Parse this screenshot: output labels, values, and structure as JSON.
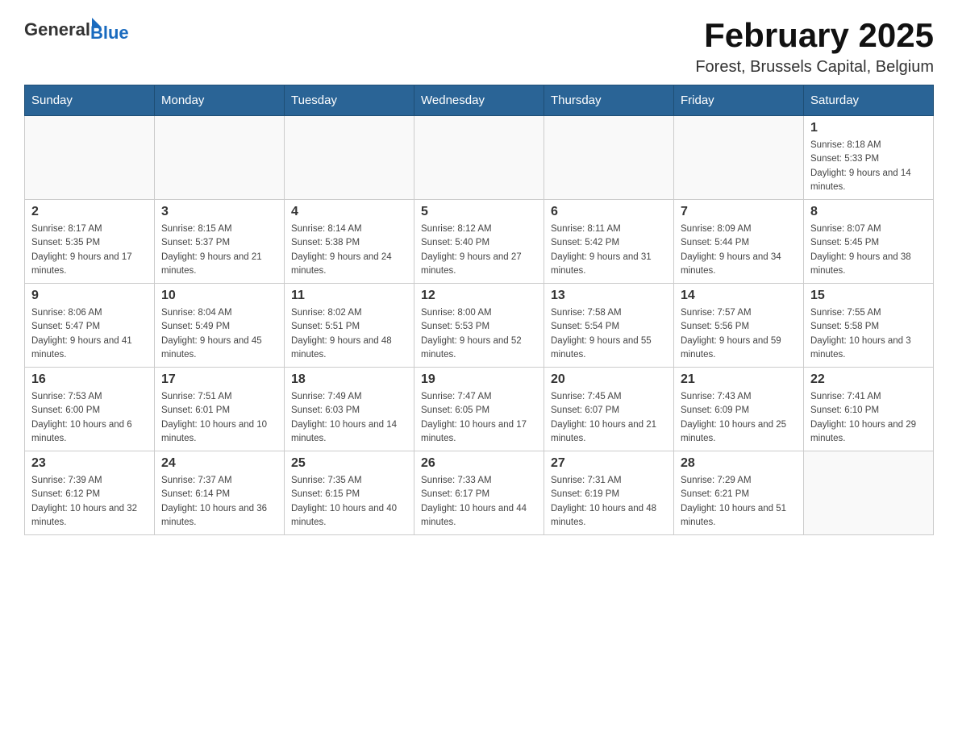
{
  "header": {
    "logo_general": "General",
    "logo_blue": "Blue",
    "title": "February 2025",
    "subtitle": "Forest, Brussels Capital, Belgium"
  },
  "days_of_week": [
    "Sunday",
    "Monday",
    "Tuesday",
    "Wednesday",
    "Thursday",
    "Friday",
    "Saturday"
  ],
  "weeks": [
    [
      {
        "day": "",
        "info": ""
      },
      {
        "day": "",
        "info": ""
      },
      {
        "day": "",
        "info": ""
      },
      {
        "day": "",
        "info": ""
      },
      {
        "day": "",
        "info": ""
      },
      {
        "day": "",
        "info": ""
      },
      {
        "day": "1",
        "info": "Sunrise: 8:18 AM\nSunset: 5:33 PM\nDaylight: 9 hours and 14 minutes."
      }
    ],
    [
      {
        "day": "2",
        "info": "Sunrise: 8:17 AM\nSunset: 5:35 PM\nDaylight: 9 hours and 17 minutes."
      },
      {
        "day": "3",
        "info": "Sunrise: 8:15 AM\nSunset: 5:37 PM\nDaylight: 9 hours and 21 minutes."
      },
      {
        "day": "4",
        "info": "Sunrise: 8:14 AM\nSunset: 5:38 PM\nDaylight: 9 hours and 24 minutes."
      },
      {
        "day": "5",
        "info": "Sunrise: 8:12 AM\nSunset: 5:40 PM\nDaylight: 9 hours and 27 minutes."
      },
      {
        "day": "6",
        "info": "Sunrise: 8:11 AM\nSunset: 5:42 PM\nDaylight: 9 hours and 31 minutes."
      },
      {
        "day": "7",
        "info": "Sunrise: 8:09 AM\nSunset: 5:44 PM\nDaylight: 9 hours and 34 minutes."
      },
      {
        "day": "8",
        "info": "Sunrise: 8:07 AM\nSunset: 5:45 PM\nDaylight: 9 hours and 38 minutes."
      }
    ],
    [
      {
        "day": "9",
        "info": "Sunrise: 8:06 AM\nSunset: 5:47 PM\nDaylight: 9 hours and 41 minutes."
      },
      {
        "day": "10",
        "info": "Sunrise: 8:04 AM\nSunset: 5:49 PM\nDaylight: 9 hours and 45 minutes."
      },
      {
        "day": "11",
        "info": "Sunrise: 8:02 AM\nSunset: 5:51 PM\nDaylight: 9 hours and 48 minutes."
      },
      {
        "day": "12",
        "info": "Sunrise: 8:00 AM\nSunset: 5:53 PM\nDaylight: 9 hours and 52 minutes."
      },
      {
        "day": "13",
        "info": "Sunrise: 7:58 AM\nSunset: 5:54 PM\nDaylight: 9 hours and 55 minutes."
      },
      {
        "day": "14",
        "info": "Sunrise: 7:57 AM\nSunset: 5:56 PM\nDaylight: 9 hours and 59 minutes."
      },
      {
        "day": "15",
        "info": "Sunrise: 7:55 AM\nSunset: 5:58 PM\nDaylight: 10 hours and 3 minutes."
      }
    ],
    [
      {
        "day": "16",
        "info": "Sunrise: 7:53 AM\nSunset: 6:00 PM\nDaylight: 10 hours and 6 minutes."
      },
      {
        "day": "17",
        "info": "Sunrise: 7:51 AM\nSunset: 6:01 PM\nDaylight: 10 hours and 10 minutes."
      },
      {
        "day": "18",
        "info": "Sunrise: 7:49 AM\nSunset: 6:03 PM\nDaylight: 10 hours and 14 minutes."
      },
      {
        "day": "19",
        "info": "Sunrise: 7:47 AM\nSunset: 6:05 PM\nDaylight: 10 hours and 17 minutes."
      },
      {
        "day": "20",
        "info": "Sunrise: 7:45 AM\nSunset: 6:07 PM\nDaylight: 10 hours and 21 minutes."
      },
      {
        "day": "21",
        "info": "Sunrise: 7:43 AM\nSunset: 6:09 PM\nDaylight: 10 hours and 25 minutes."
      },
      {
        "day": "22",
        "info": "Sunrise: 7:41 AM\nSunset: 6:10 PM\nDaylight: 10 hours and 29 minutes."
      }
    ],
    [
      {
        "day": "23",
        "info": "Sunrise: 7:39 AM\nSunset: 6:12 PM\nDaylight: 10 hours and 32 minutes."
      },
      {
        "day": "24",
        "info": "Sunrise: 7:37 AM\nSunset: 6:14 PM\nDaylight: 10 hours and 36 minutes."
      },
      {
        "day": "25",
        "info": "Sunrise: 7:35 AM\nSunset: 6:15 PM\nDaylight: 10 hours and 40 minutes."
      },
      {
        "day": "26",
        "info": "Sunrise: 7:33 AM\nSunset: 6:17 PM\nDaylight: 10 hours and 44 minutes."
      },
      {
        "day": "27",
        "info": "Sunrise: 7:31 AM\nSunset: 6:19 PM\nDaylight: 10 hours and 48 minutes."
      },
      {
        "day": "28",
        "info": "Sunrise: 7:29 AM\nSunset: 6:21 PM\nDaylight: 10 hours and 51 minutes."
      },
      {
        "day": "",
        "info": ""
      }
    ]
  ]
}
